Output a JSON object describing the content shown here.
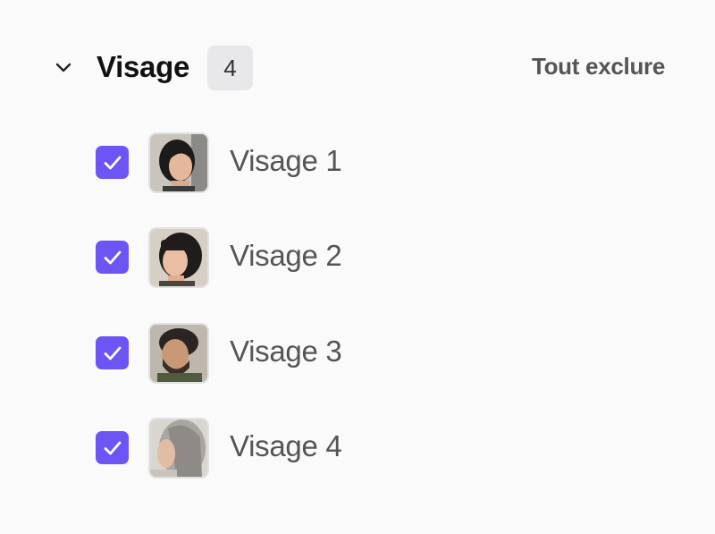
{
  "section": {
    "title": "Visage",
    "count": "4",
    "exclude_all_label": "Tout exclure",
    "expanded_icon": "chevron-down-icon"
  },
  "colors": {
    "checkbox": "#6b55f5",
    "check_mark": "#ffffff",
    "badge_bg": "#e8e8ea"
  },
  "faces": [
    {
      "label": "Visage 1",
      "checked": true,
      "thumbnail": "woman-short-dark-hair-thumbnail"
    },
    {
      "label": "Visage 2",
      "checked": true,
      "thumbnail": "woman-bangs-dark-hair-thumbnail"
    },
    {
      "label": "Visage 3",
      "checked": true,
      "thumbnail": "man-beard-dark-hair-thumbnail"
    },
    {
      "label": "Visage 4",
      "checked": true,
      "thumbnail": "older-person-gray-hair-thumbnail"
    }
  ]
}
